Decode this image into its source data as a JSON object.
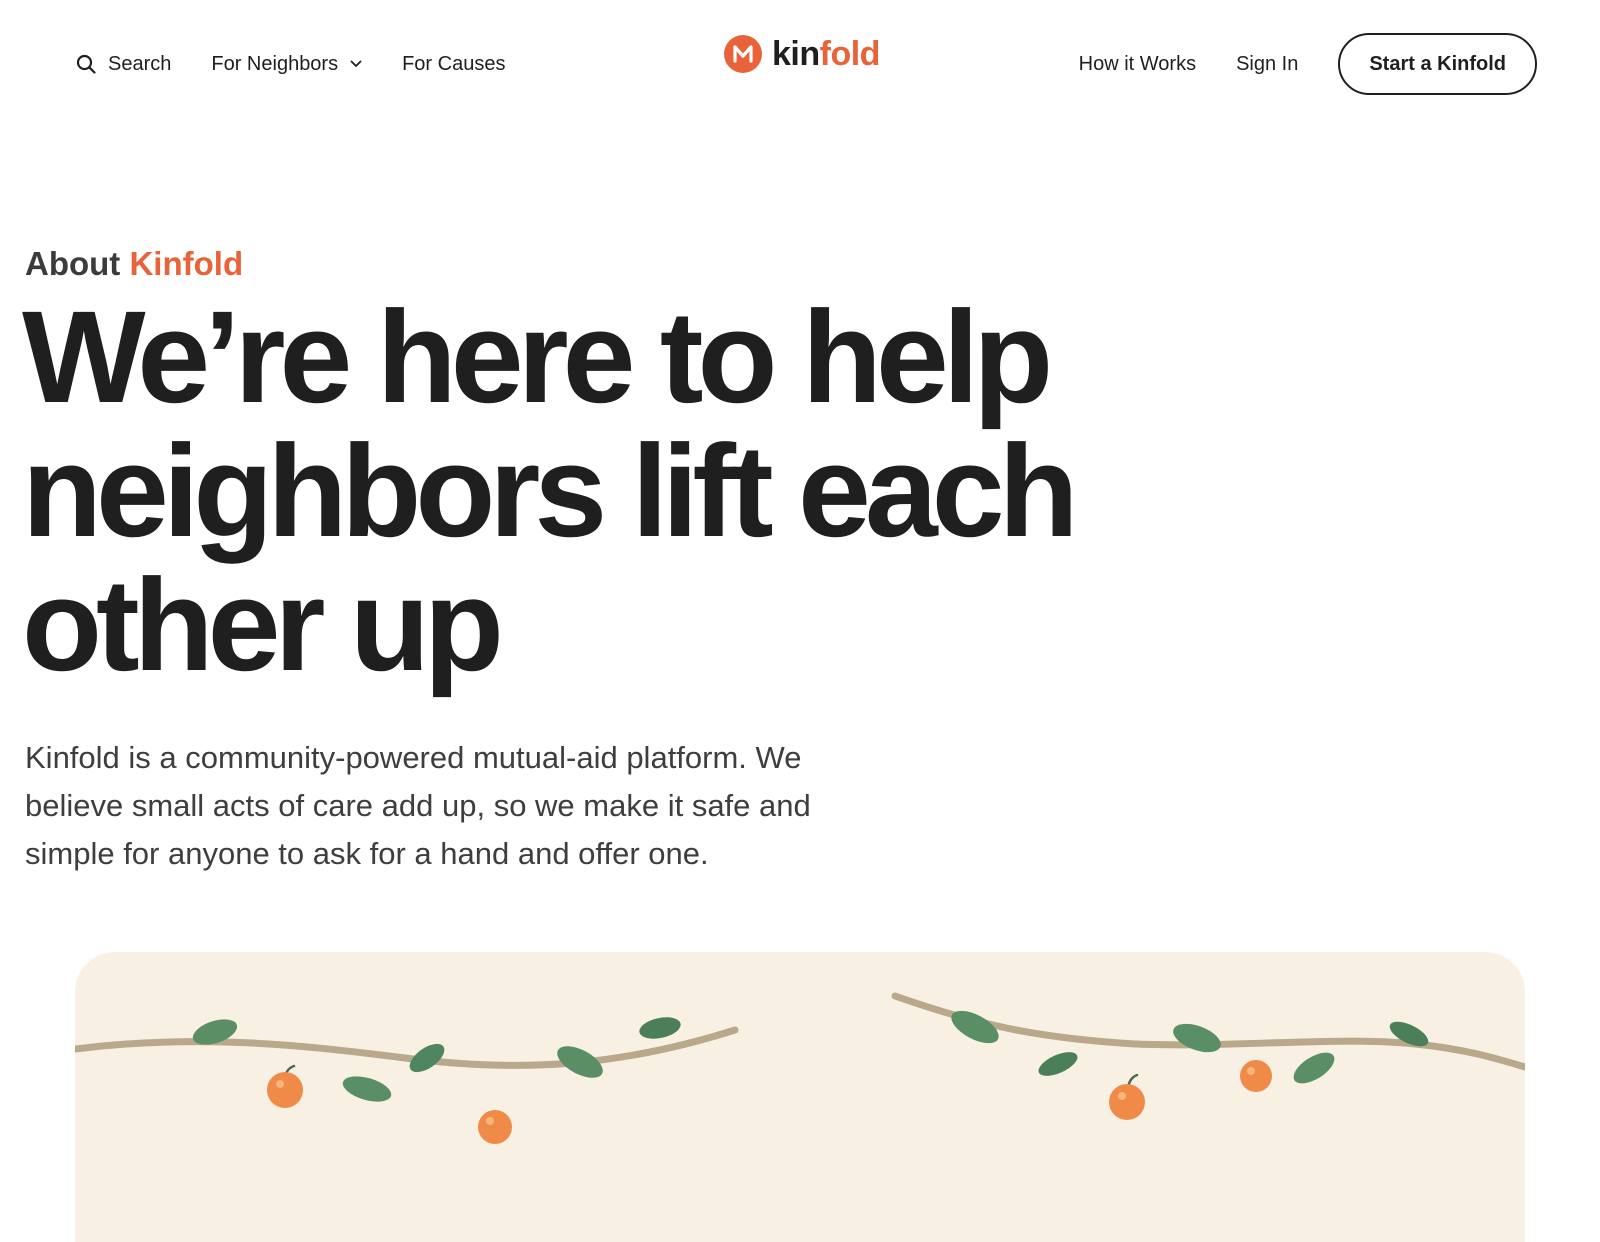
{
  "nav": {
    "search_label": "Search",
    "neighbors_label": "For Neighbors",
    "causes_label": "For Causes",
    "how_label": "How it Works",
    "signin_label": "Sign In",
    "cta_label": "Start a Kinfold",
    "icons": {
      "search": "search-icon",
      "dropdown": "chevron-down-icon"
    }
  },
  "brand": {
    "mark_letter": "M",
    "name_prefix": "kin",
    "name_suffix": "fold"
  },
  "hero": {
    "eyebrow_prefix": "About ",
    "eyebrow_accent": "Kinfold",
    "headline": "We’re here to help neighbors lift each other up",
    "lede": "Kinfold is a community-powered mutual-aid platform. We believe small acts of care add up, so we make it safe and simple for anyone to ask for a hand and offer one."
  },
  "colors": {
    "accent": "#e8623a",
    "text": "#1f1f1f",
    "illustration_bg": "#f8f0e3",
    "vine": "#b9a88a",
    "leaf": "#5a8f66",
    "fruit": "#ef8a48"
  }
}
